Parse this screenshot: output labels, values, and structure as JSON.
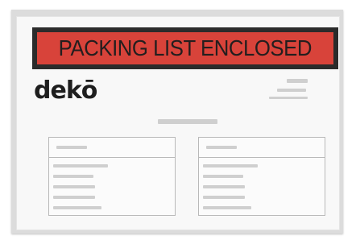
{
  "label": {
    "banner_text": "PACKING LIST ENCLOSED",
    "brand": "dekō"
  },
  "colors": {
    "banner_red": "#d8433a",
    "banner_frame": "#2b2b2b",
    "envelope": "#dcdcdc",
    "placeholder": "#cfcfcf"
  }
}
